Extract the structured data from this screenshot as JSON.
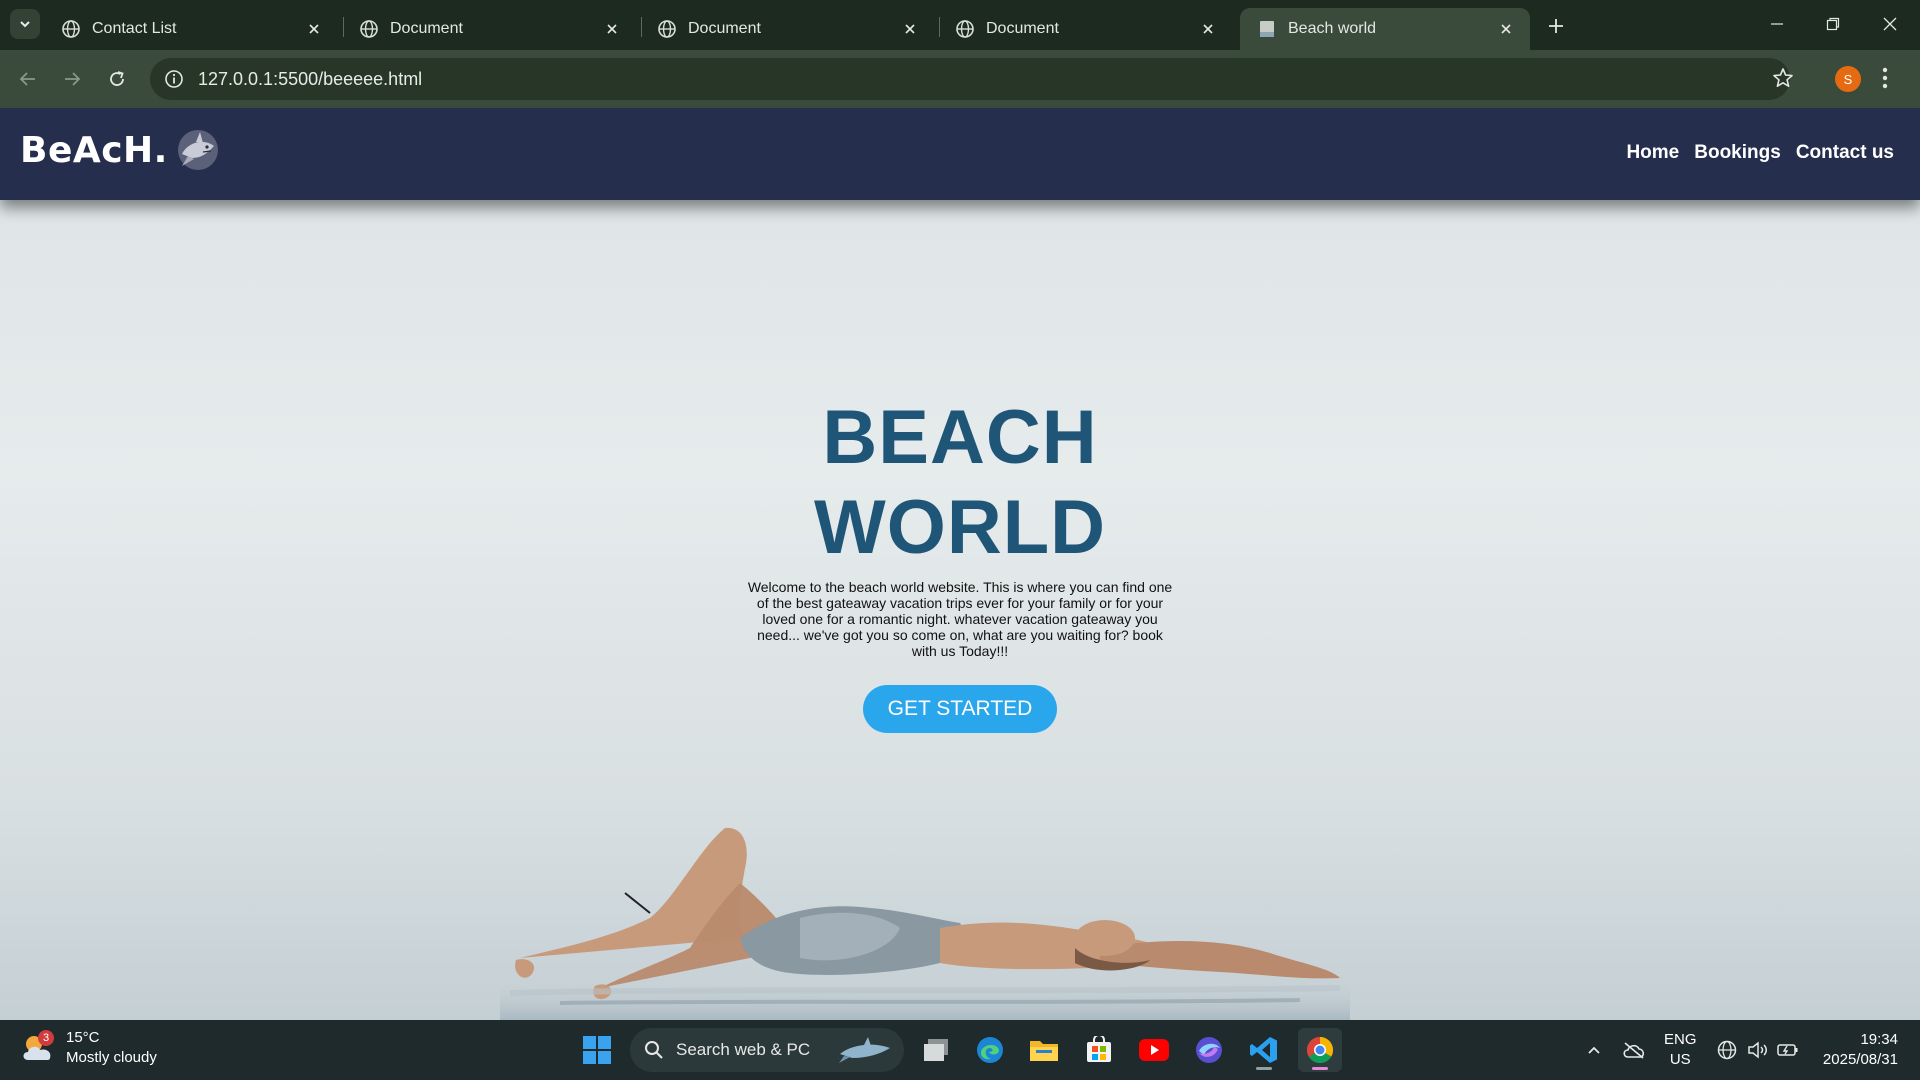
{
  "browser": {
    "tabs": [
      {
        "label": "Contact List",
        "active": false
      },
      {
        "label": "Document",
        "active": false
      },
      {
        "label": "Document",
        "active": false
      },
      {
        "label": "Document",
        "active": false
      },
      {
        "label": "Beach world",
        "active": true
      }
    ],
    "url": "127.0.0.1:5500/beeeee.html",
    "profile_initial": "S"
  },
  "site": {
    "brand": "BeAcH.",
    "nav": [
      "Home",
      "Bookings",
      "Contact us"
    ],
    "hero": {
      "title_line1": "BEACH",
      "title_line2": "WORLD",
      "description": "Welcome to the beach world website. This is where you can find one of the best gateaway vacation trips ever for your family or for your loved one for a romantic night. whatever vacation gateaway you need... we've got you so come on, what are you waiting for? book with us Today!!!",
      "cta": "GET STARTED"
    }
  },
  "taskbar": {
    "weather": {
      "temp": "15°C",
      "condition": "Mostly cloudy",
      "badge": "3"
    },
    "search_placeholder": "Search web & PC",
    "apps": [
      "task-view",
      "edge",
      "file-explorer",
      "microsoft-store",
      "youtube",
      "copilot",
      "vscode",
      "chrome"
    ],
    "language": {
      "line1": "ENG",
      "line2": "US"
    },
    "time": "19:34",
    "date": "2025/08/31"
  },
  "colors": {
    "nav_bg": "#252e4c",
    "title": "#1f5677",
    "cta_bg": "#2aa6ec",
    "browser_frame": "#1d2a1f"
  }
}
